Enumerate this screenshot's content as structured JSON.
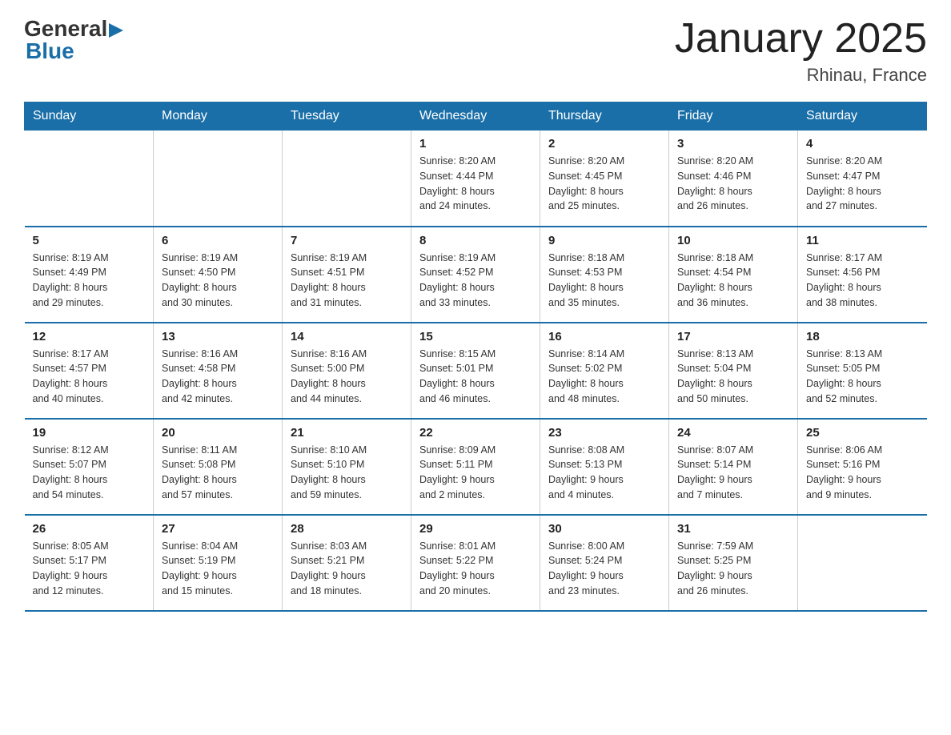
{
  "header": {
    "logo_general": "General",
    "logo_blue": "Blue",
    "title": "January 2025",
    "location": "Rhinau, France"
  },
  "days_of_week": [
    "Sunday",
    "Monday",
    "Tuesday",
    "Wednesday",
    "Thursday",
    "Friday",
    "Saturday"
  ],
  "weeks": [
    {
      "days": [
        {
          "number": "",
          "info": ""
        },
        {
          "number": "",
          "info": ""
        },
        {
          "number": "",
          "info": ""
        },
        {
          "number": "1",
          "info": "Sunrise: 8:20 AM\nSunset: 4:44 PM\nDaylight: 8 hours\nand 24 minutes."
        },
        {
          "number": "2",
          "info": "Sunrise: 8:20 AM\nSunset: 4:45 PM\nDaylight: 8 hours\nand 25 minutes."
        },
        {
          "number": "3",
          "info": "Sunrise: 8:20 AM\nSunset: 4:46 PM\nDaylight: 8 hours\nand 26 minutes."
        },
        {
          "number": "4",
          "info": "Sunrise: 8:20 AM\nSunset: 4:47 PM\nDaylight: 8 hours\nand 27 minutes."
        }
      ]
    },
    {
      "days": [
        {
          "number": "5",
          "info": "Sunrise: 8:19 AM\nSunset: 4:49 PM\nDaylight: 8 hours\nand 29 minutes."
        },
        {
          "number": "6",
          "info": "Sunrise: 8:19 AM\nSunset: 4:50 PM\nDaylight: 8 hours\nand 30 minutes."
        },
        {
          "number": "7",
          "info": "Sunrise: 8:19 AM\nSunset: 4:51 PM\nDaylight: 8 hours\nand 31 minutes."
        },
        {
          "number": "8",
          "info": "Sunrise: 8:19 AM\nSunset: 4:52 PM\nDaylight: 8 hours\nand 33 minutes."
        },
        {
          "number": "9",
          "info": "Sunrise: 8:18 AM\nSunset: 4:53 PM\nDaylight: 8 hours\nand 35 minutes."
        },
        {
          "number": "10",
          "info": "Sunrise: 8:18 AM\nSunset: 4:54 PM\nDaylight: 8 hours\nand 36 minutes."
        },
        {
          "number": "11",
          "info": "Sunrise: 8:17 AM\nSunset: 4:56 PM\nDaylight: 8 hours\nand 38 minutes."
        }
      ]
    },
    {
      "days": [
        {
          "number": "12",
          "info": "Sunrise: 8:17 AM\nSunset: 4:57 PM\nDaylight: 8 hours\nand 40 minutes."
        },
        {
          "number": "13",
          "info": "Sunrise: 8:16 AM\nSunset: 4:58 PM\nDaylight: 8 hours\nand 42 minutes."
        },
        {
          "number": "14",
          "info": "Sunrise: 8:16 AM\nSunset: 5:00 PM\nDaylight: 8 hours\nand 44 minutes."
        },
        {
          "number": "15",
          "info": "Sunrise: 8:15 AM\nSunset: 5:01 PM\nDaylight: 8 hours\nand 46 minutes."
        },
        {
          "number": "16",
          "info": "Sunrise: 8:14 AM\nSunset: 5:02 PM\nDaylight: 8 hours\nand 48 minutes."
        },
        {
          "number": "17",
          "info": "Sunrise: 8:13 AM\nSunset: 5:04 PM\nDaylight: 8 hours\nand 50 minutes."
        },
        {
          "number": "18",
          "info": "Sunrise: 8:13 AM\nSunset: 5:05 PM\nDaylight: 8 hours\nand 52 minutes."
        }
      ]
    },
    {
      "days": [
        {
          "number": "19",
          "info": "Sunrise: 8:12 AM\nSunset: 5:07 PM\nDaylight: 8 hours\nand 54 minutes."
        },
        {
          "number": "20",
          "info": "Sunrise: 8:11 AM\nSunset: 5:08 PM\nDaylight: 8 hours\nand 57 minutes."
        },
        {
          "number": "21",
          "info": "Sunrise: 8:10 AM\nSunset: 5:10 PM\nDaylight: 8 hours\nand 59 minutes."
        },
        {
          "number": "22",
          "info": "Sunrise: 8:09 AM\nSunset: 5:11 PM\nDaylight: 9 hours\nand 2 minutes."
        },
        {
          "number": "23",
          "info": "Sunrise: 8:08 AM\nSunset: 5:13 PM\nDaylight: 9 hours\nand 4 minutes."
        },
        {
          "number": "24",
          "info": "Sunrise: 8:07 AM\nSunset: 5:14 PM\nDaylight: 9 hours\nand 7 minutes."
        },
        {
          "number": "25",
          "info": "Sunrise: 8:06 AM\nSunset: 5:16 PM\nDaylight: 9 hours\nand 9 minutes."
        }
      ]
    },
    {
      "days": [
        {
          "number": "26",
          "info": "Sunrise: 8:05 AM\nSunset: 5:17 PM\nDaylight: 9 hours\nand 12 minutes."
        },
        {
          "number": "27",
          "info": "Sunrise: 8:04 AM\nSunset: 5:19 PM\nDaylight: 9 hours\nand 15 minutes."
        },
        {
          "number": "28",
          "info": "Sunrise: 8:03 AM\nSunset: 5:21 PM\nDaylight: 9 hours\nand 18 minutes."
        },
        {
          "number": "29",
          "info": "Sunrise: 8:01 AM\nSunset: 5:22 PM\nDaylight: 9 hours\nand 20 minutes."
        },
        {
          "number": "30",
          "info": "Sunrise: 8:00 AM\nSunset: 5:24 PM\nDaylight: 9 hours\nand 23 minutes."
        },
        {
          "number": "31",
          "info": "Sunrise: 7:59 AM\nSunset: 5:25 PM\nDaylight: 9 hours\nand 26 minutes."
        },
        {
          "number": "",
          "info": ""
        }
      ]
    }
  ]
}
